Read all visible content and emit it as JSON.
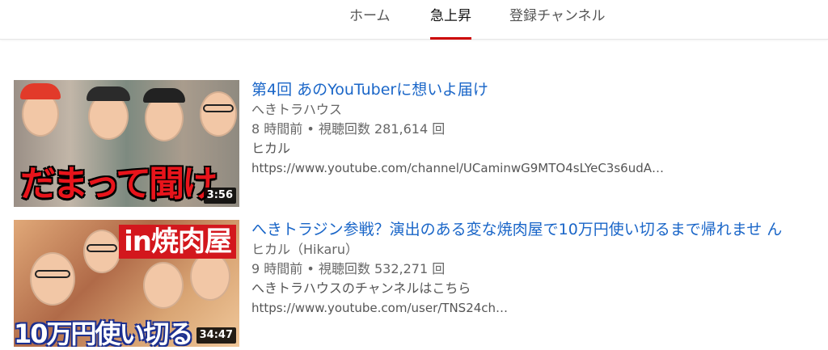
{
  "tabs": {
    "home": "ホーム",
    "trending": "急上昇",
    "subscriptions": "登録チャンネル"
  },
  "videos": [
    {
      "title": "第4回 あのYouTuberに想いよ届け",
      "channel": "へきトラハウス",
      "stats": "8 時間前 • 視聴回数 281,614 回",
      "description": "ヒカル",
      "link": "https://www.youtube.com/channel/UCaminwG9MTO4sLYeC3s6udA…",
      "duration": "3:56",
      "thumb_text": "だまって聞け"
    },
    {
      "title": "へきトラジン参戦？演出のある変な焼肉屋で10万円使い切るまで帰れませ ん",
      "channel": "ヒカル（Hikaru）",
      "stats": "9 時間前 • 視聴回数 532,271 回",
      "description": "へきトラハウスのチャンネルはこちら",
      "link": "https://www.youtube.com/user/TNS24ch…",
      "duration": "34:47",
      "thumb_text_top": "in焼肉屋",
      "thumb_text_bottom": "10万円使い切る"
    }
  ],
  "colors": {
    "accent": "#cc0000",
    "link": "#1a66c8"
  }
}
